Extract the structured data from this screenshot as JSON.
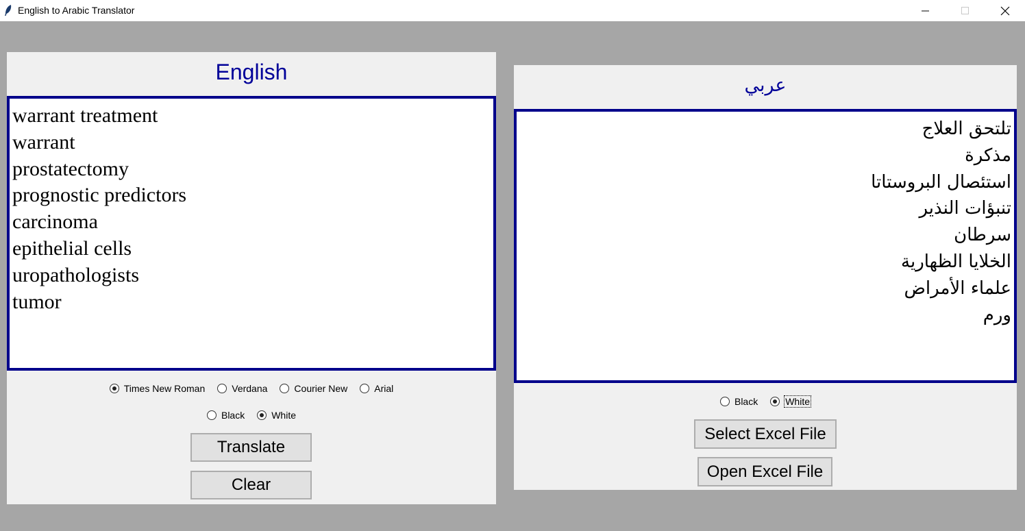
{
  "window": {
    "title": "English to Arabic Translator",
    "minimize_icon": "minimize-icon",
    "maximize_icon": "maximize-icon",
    "close_icon": "close-icon"
  },
  "left": {
    "heading": "English",
    "lines": [
      "warrant treatment",
      "warrant",
      "prostatectomy",
      "prognostic predictors",
      "carcinoma",
      "epithelial cells",
      "uropathologists",
      "tumor"
    ],
    "fonts": [
      "Times New Roman",
      "Verdana",
      "Courier New",
      "Arial"
    ],
    "selected_font": "Times New Roman",
    "colors": [
      "Black",
      "White"
    ],
    "selected_color": "White",
    "translate_label": "Translate",
    "clear_label": "Clear"
  },
  "right": {
    "heading": "عربي",
    "lines": [
      "تلتحق العلاج",
      "مذكرة",
      "استئصال البروستاتا",
      "تنبؤات النذير",
      "سرطان",
      "الخلايا الظهارية",
      "علماء الأمراض",
      "ورم"
    ],
    "colors": [
      "Black",
      "White"
    ],
    "selected_color": "White",
    "select_excel_label": "Select Excel File",
    "open_excel_label": "Open Excel File"
  },
  "theme": {
    "background": "#a6a6a6",
    "panel": "#f0f0f0",
    "accent": "#000099",
    "border": "#00008b"
  }
}
